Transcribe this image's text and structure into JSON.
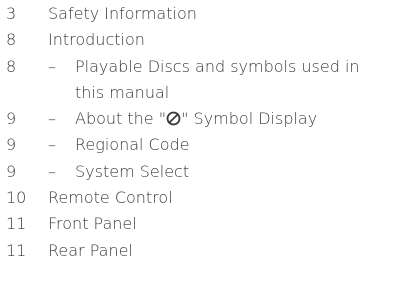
{
  "toc": {
    "entries": [
      {
        "page": "3",
        "text": "Safety Information"
      },
      {
        "page": "8",
        "text": "Introduction"
      },
      {
        "page": "8",
        "dash": "–",
        "text": "Playable Discs and symbols used in",
        "continuation": "this manual"
      },
      {
        "page": "9",
        "dash": "–",
        "text_before": "About the \"",
        "text_after": "\" Symbol Display",
        "icon": "prohibited-symbol-icon"
      },
      {
        "page": "9",
        "dash": "–",
        "text": "Regional Code"
      },
      {
        "page": "9",
        "dash": "–",
        "text": "System Select"
      },
      {
        "page": "10",
        "text": "Remote Control"
      },
      {
        "page": "11",
        "text": "Front Panel"
      },
      {
        "page": "11",
        "text": "Rear Panel"
      }
    ]
  }
}
